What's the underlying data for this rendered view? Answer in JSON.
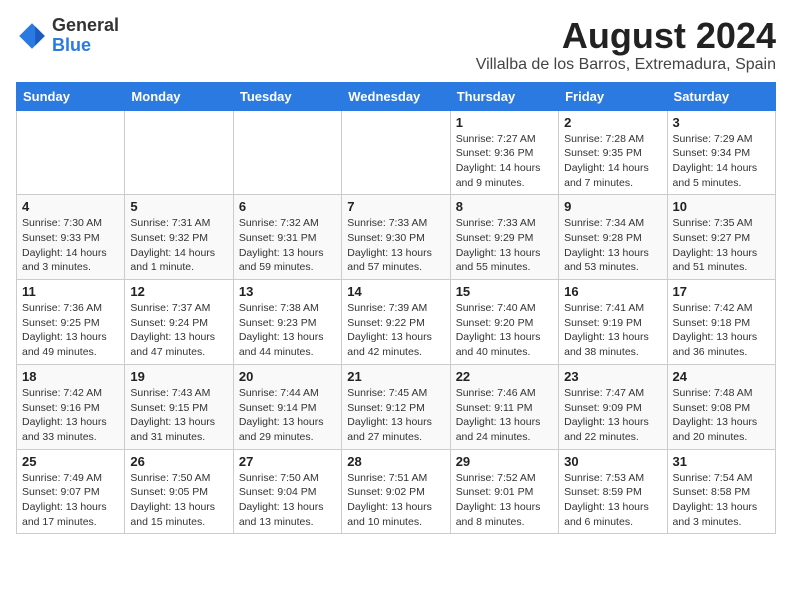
{
  "header": {
    "logo_general": "General",
    "logo_blue": "Blue",
    "month_title": "August 2024",
    "location": "Villalba de los Barros, Extremadura, Spain"
  },
  "columns": [
    "Sunday",
    "Monday",
    "Tuesday",
    "Wednesday",
    "Thursday",
    "Friday",
    "Saturday"
  ],
  "weeks": [
    [
      {
        "day": "",
        "info": ""
      },
      {
        "day": "",
        "info": ""
      },
      {
        "day": "",
        "info": ""
      },
      {
        "day": "",
        "info": ""
      },
      {
        "day": "1",
        "info": "Sunrise: 7:27 AM\nSunset: 9:36 PM\nDaylight: 14 hours\nand 9 minutes."
      },
      {
        "day": "2",
        "info": "Sunrise: 7:28 AM\nSunset: 9:35 PM\nDaylight: 14 hours\nand 7 minutes."
      },
      {
        "day": "3",
        "info": "Sunrise: 7:29 AM\nSunset: 9:34 PM\nDaylight: 14 hours\nand 5 minutes."
      }
    ],
    [
      {
        "day": "4",
        "info": "Sunrise: 7:30 AM\nSunset: 9:33 PM\nDaylight: 14 hours\nand 3 minutes."
      },
      {
        "day": "5",
        "info": "Sunrise: 7:31 AM\nSunset: 9:32 PM\nDaylight: 14 hours\nand 1 minute."
      },
      {
        "day": "6",
        "info": "Sunrise: 7:32 AM\nSunset: 9:31 PM\nDaylight: 13 hours\nand 59 minutes."
      },
      {
        "day": "7",
        "info": "Sunrise: 7:33 AM\nSunset: 9:30 PM\nDaylight: 13 hours\nand 57 minutes."
      },
      {
        "day": "8",
        "info": "Sunrise: 7:33 AM\nSunset: 9:29 PM\nDaylight: 13 hours\nand 55 minutes."
      },
      {
        "day": "9",
        "info": "Sunrise: 7:34 AM\nSunset: 9:28 PM\nDaylight: 13 hours\nand 53 minutes."
      },
      {
        "day": "10",
        "info": "Sunrise: 7:35 AM\nSunset: 9:27 PM\nDaylight: 13 hours\nand 51 minutes."
      }
    ],
    [
      {
        "day": "11",
        "info": "Sunrise: 7:36 AM\nSunset: 9:25 PM\nDaylight: 13 hours\nand 49 minutes."
      },
      {
        "day": "12",
        "info": "Sunrise: 7:37 AM\nSunset: 9:24 PM\nDaylight: 13 hours\nand 47 minutes."
      },
      {
        "day": "13",
        "info": "Sunrise: 7:38 AM\nSunset: 9:23 PM\nDaylight: 13 hours\nand 44 minutes."
      },
      {
        "day": "14",
        "info": "Sunrise: 7:39 AM\nSunset: 9:22 PM\nDaylight: 13 hours\nand 42 minutes."
      },
      {
        "day": "15",
        "info": "Sunrise: 7:40 AM\nSunset: 9:20 PM\nDaylight: 13 hours\nand 40 minutes."
      },
      {
        "day": "16",
        "info": "Sunrise: 7:41 AM\nSunset: 9:19 PM\nDaylight: 13 hours\nand 38 minutes."
      },
      {
        "day": "17",
        "info": "Sunrise: 7:42 AM\nSunset: 9:18 PM\nDaylight: 13 hours\nand 36 minutes."
      }
    ],
    [
      {
        "day": "18",
        "info": "Sunrise: 7:42 AM\nSunset: 9:16 PM\nDaylight: 13 hours\nand 33 minutes."
      },
      {
        "day": "19",
        "info": "Sunrise: 7:43 AM\nSunset: 9:15 PM\nDaylight: 13 hours\nand 31 minutes."
      },
      {
        "day": "20",
        "info": "Sunrise: 7:44 AM\nSunset: 9:14 PM\nDaylight: 13 hours\nand 29 minutes."
      },
      {
        "day": "21",
        "info": "Sunrise: 7:45 AM\nSunset: 9:12 PM\nDaylight: 13 hours\nand 27 minutes."
      },
      {
        "day": "22",
        "info": "Sunrise: 7:46 AM\nSunset: 9:11 PM\nDaylight: 13 hours\nand 24 minutes."
      },
      {
        "day": "23",
        "info": "Sunrise: 7:47 AM\nSunset: 9:09 PM\nDaylight: 13 hours\nand 22 minutes."
      },
      {
        "day": "24",
        "info": "Sunrise: 7:48 AM\nSunset: 9:08 PM\nDaylight: 13 hours\nand 20 minutes."
      }
    ],
    [
      {
        "day": "25",
        "info": "Sunrise: 7:49 AM\nSunset: 9:07 PM\nDaylight: 13 hours\nand 17 minutes."
      },
      {
        "day": "26",
        "info": "Sunrise: 7:50 AM\nSunset: 9:05 PM\nDaylight: 13 hours\nand 15 minutes."
      },
      {
        "day": "27",
        "info": "Sunrise: 7:50 AM\nSunset: 9:04 PM\nDaylight: 13 hours\nand 13 minutes."
      },
      {
        "day": "28",
        "info": "Sunrise: 7:51 AM\nSunset: 9:02 PM\nDaylight: 13 hours\nand 10 minutes."
      },
      {
        "day": "29",
        "info": "Sunrise: 7:52 AM\nSunset: 9:01 PM\nDaylight: 13 hours\nand 8 minutes."
      },
      {
        "day": "30",
        "info": "Sunrise: 7:53 AM\nSunset: 8:59 PM\nDaylight: 13 hours\nand 6 minutes."
      },
      {
        "day": "31",
        "info": "Sunrise: 7:54 AM\nSunset: 8:58 PM\nDaylight: 13 hours\nand 3 minutes."
      }
    ]
  ]
}
